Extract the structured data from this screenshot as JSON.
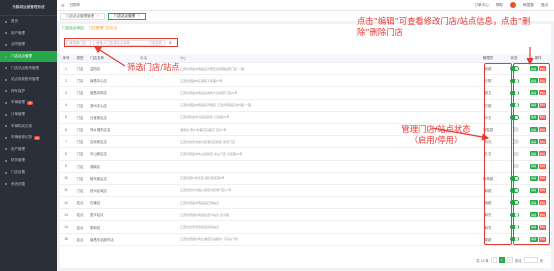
{
  "app": {
    "logo": "东鹤城运营管理系统"
  },
  "sidebar": {
    "items": [
      {
        "label": "首页"
      },
      {
        "label": "用户管理"
      },
      {
        "label": "合同管理"
      },
      {
        "label": "门店站点管理",
        "active": true
      },
      {
        "label": "门店站点账号管理"
      },
      {
        "label": "站点收款账号管理"
      },
      {
        "label": "押车保护"
      },
      {
        "label": "车辆管理",
        "badge": "12"
      },
      {
        "label": "订单管理"
      },
      {
        "label": "车辆购买记录"
      },
      {
        "label": "车辆维修记录",
        "badge": "12"
      },
      {
        "label": "用户管理"
      },
      {
        "label": "财务管理"
      },
      {
        "label": "门店设置"
      },
      {
        "label": "系统设置"
      }
    ]
  },
  "topbar": {
    "title": "已购车",
    "right_items": [
      "订单中心",
      "帮助",
      "韩国整",
      "登出"
    ]
  },
  "tabs": [
    {
      "label": "门店站点管理管理"
    },
    {
      "label": "门店站点管理",
      "active": true
    }
  ],
  "quick_links": {
    "link1": "门店站点添加",
    "link2": "门店管理门店站点"
  },
  "filter": {
    "select_placeholder": "请选择门店",
    "input_placeholder": "请输入门店或站点名称",
    "input_hint": "门店名称"
  },
  "table": {
    "headers": {
      "no": "序号",
      "type": "类型",
      "name": "门店名称",
      "phone": "电话",
      "addr": "地址",
      "mgr": "管理员",
      "status": "状态",
      "op": "操作"
    },
    "edit_label": "编辑",
    "delete_label": "删除",
    "rows": [
      {
        "no": "1",
        "type": "门店",
        "name": "益阳店",
        "phone": "",
        "addr": "江西省南昌市南昌县湾里区招贤镇益阳门店·一镇",
        "mgr": "张超",
        "on": true
      },
      {
        "no": "2",
        "type": "门店",
        "name": "南昌中心店",
        "phone": "",
        "addr": "江西省南昌市东湖区人民路27号",
        "mgr": "王刚",
        "on": true
      },
      {
        "no": "3",
        "type": "门店",
        "name": "南昌向阳店",
        "phone": "",
        "addr": "江西省南昌市南昌县向阳大道向阳门店23号",
        "mgr": "超五",
        "on": true
      },
      {
        "no": "4",
        "type": "门店",
        "name": "滨州中心店",
        "phone": "",
        "addr": "江西省南昌市南昌县湾里区·江西省南昌县滨州路·一镇",
        "mgr": "万超",
        "on": true
      },
      {
        "no": "5",
        "type": "门店",
        "name": "分宜新区店",
        "phone": "",
        "addr": "江西省新余市分宜县新区·分宜路23号",
        "mgr": "中文",
        "on": true
      },
      {
        "no": "6",
        "type": "门店",
        "name": "萍乡湘东区店",
        "phone": "",
        "addr": "湖南省·萍乡市湘东区湘东门店27号",
        "mgr": "刘胜超",
        "on": false
      },
      {
        "no": "7",
        "type": "门店",
        "name": "吉安新区店",
        "phone": "",
        "addr": "江西省吉安市吉州区湘东区新区·吉安门店",
        "mgr": "刘光",
        "on": false
      },
      {
        "no": "8",
        "type": "门店",
        "name": "中山新区店",
        "phone": "",
        "addr": "江西省南昌市中山区新区·中山门店·分宜路12号",
        "mgr": "孔文",
        "on": false
      },
      {
        "no": "9",
        "type": "门店",
        "name": "湘南店",
        "phone": "",
        "addr": "",
        "mgr": "",
        "on": false
      },
      {
        "no": "10",
        "type": "门店",
        "name": "赣东新区店",
        "phone": "",
        "addr": "江西省赣州市东区·赣东新区镇3号",
        "mgr": "胡林超",
        "on": true
      },
      {
        "no": "11",
        "type": "门店",
        "name": "抚州区域店",
        "phone": "",
        "addr": "江西省抚州市临川区抚州区域门店17号",
        "mgr": "韩超",
        "on": true
      },
      {
        "no": "12",
        "type": "站点",
        "name": "石塘站",
        "phone": "",
        "addr": "江西省南昌市南昌县石塘站点",
        "mgr": "胡超",
        "on": true
      },
      {
        "no": "13",
        "type": "站点",
        "name": "宽平站点",
        "phone": "",
        "addr": "江西省南昌市南昌县宽平站点·宽平路",
        "mgr": "韩杰",
        "on": true
      },
      {
        "no": "14",
        "type": "站点",
        "name": "泰和站",
        "phone": "",
        "addr": "江西省吉安市泰和县泰和站点",
        "mgr": "韩杰",
        "on": true
      },
      {
        "no": "15",
        "type": "站点",
        "name": "南昌东站超市店",
        "phone": "",
        "addr": "江西省南昌市青山湖区东站超市（东站广场）",
        "mgr": "周超",
        "on": true
      }
    ]
  },
  "annotations": {
    "filter_note": "筛选门店/站点",
    "status_note_1": "管理门店/站点状态",
    "status_note_2": "（启用/停用）",
    "edit_note_1": "点击“编辑”可查看修改门店/站点信息，点击“删",
    "edit_note_2": "除”删除门店"
  },
  "pager": {
    "total": "共 14 条",
    "prev": "‹",
    "page": "1",
    "next": "›",
    "goto": "前往",
    "unit": "页"
  },
  "colors": {
    "accent": "#27a84a",
    "annotation": "#e53935",
    "delete": "#f5503d",
    "sidebar_bg": "#2b2f3a"
  }
}
